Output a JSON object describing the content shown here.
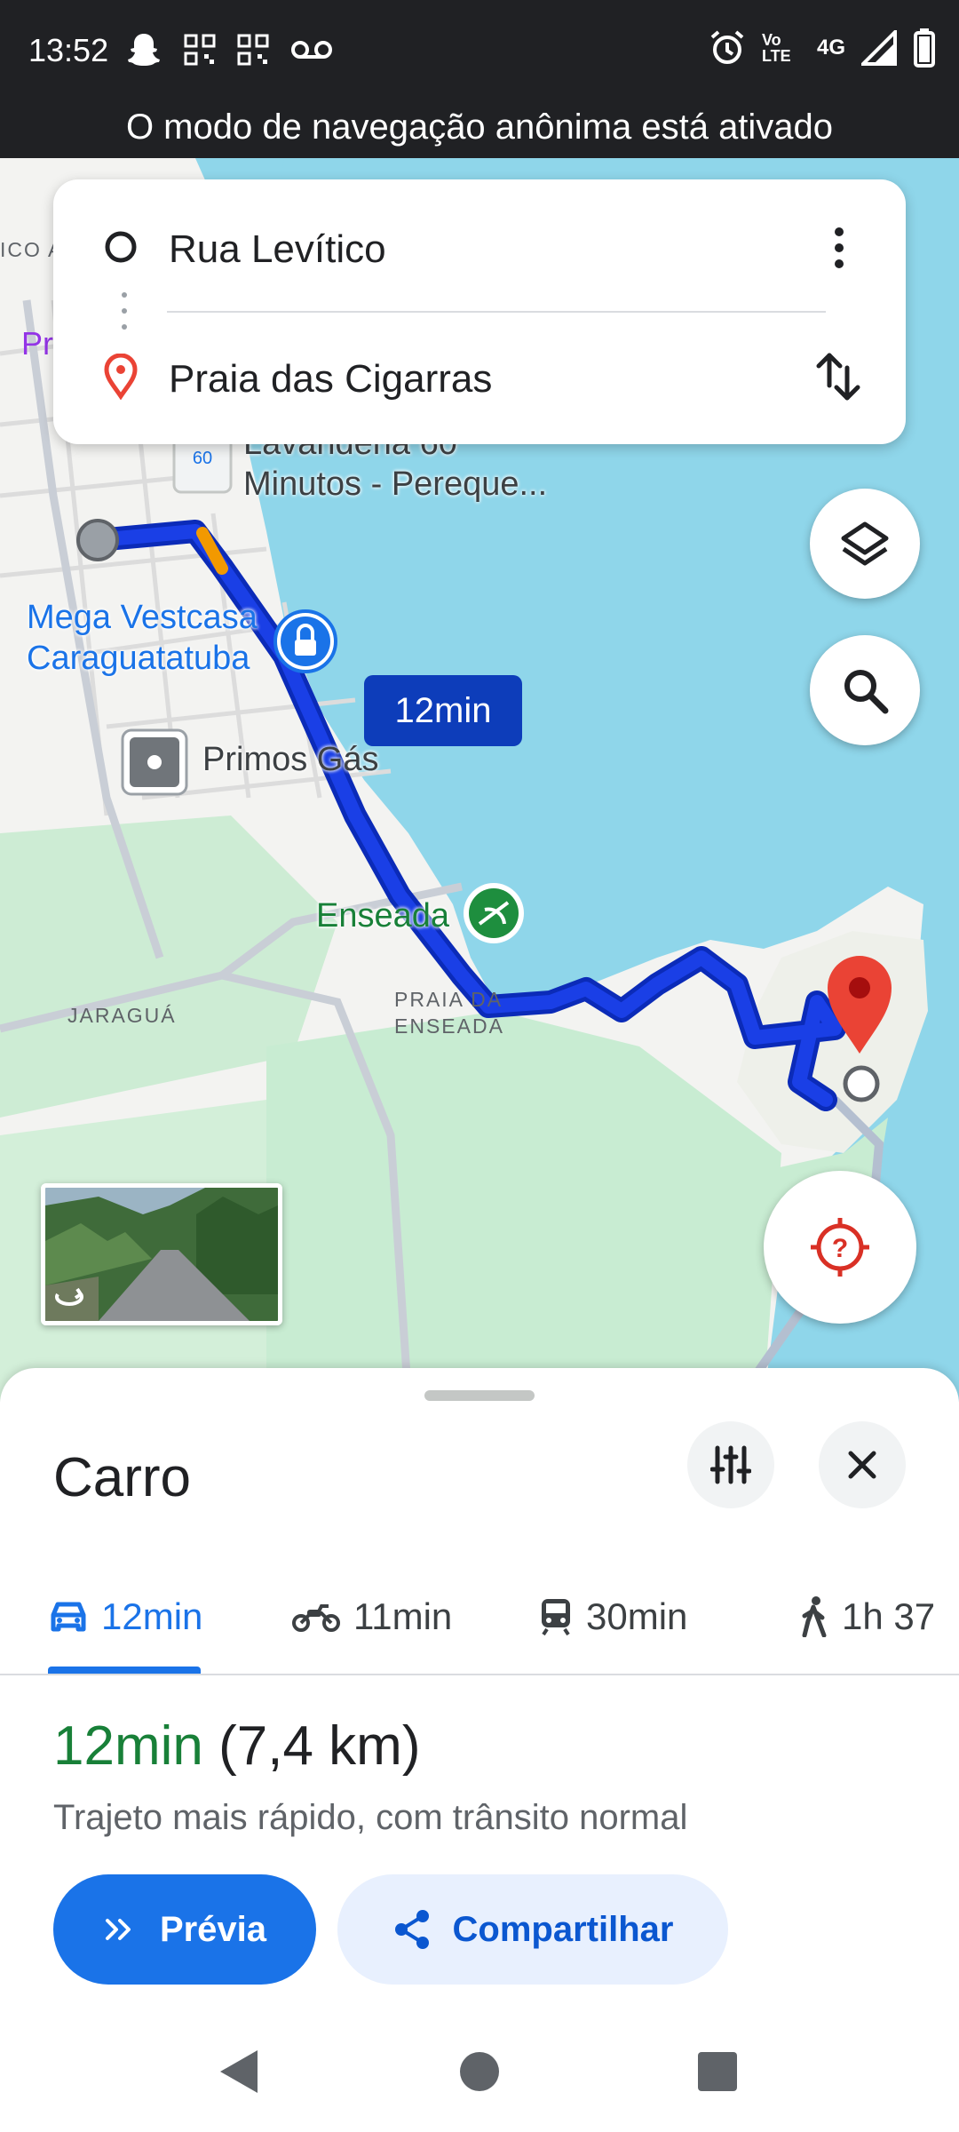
{
  "status_bar": {
    "time": "13:52",
    "network": "4G",
    "volte": "Vo LTE",
    "left_icons": [
      "snapchat-icon",
      "qr-code-icon",
      "qr-code-icon",
      "voicemail-icon"
    ],
    "right_icons": [
      "alarm-icon",
      "volte-icon",
      "signal-icon",
      "battery-icon"
    ]
  },
  "incognito_banner": "O modo de navegação anônima está ativado",
  "search": {
    "origin": "Rua Levítico",
    "destination": "Praia das Cigarras"
  },
  "map": {
    "labels": {
      "lavanderia_1": "Lavanderia 60",
      "lavanderia_2": "Minutos - Pereque...",
      "mega_1": "Mega Vestcasa",
      "mega_2": "Caraguatatuba",
      "primos": "Primos Gás",
      "enseada": "Enseada",
      "praia_1": "PRAIA DA",
      "praia_2": "ENSEADA",
      "jaragua": "JARAGUÁ",
      "edge_co": "ICO A",
      "edge_pr": "Pr"
    },
    "eta_bubble": "12min",
    "colors": {
      "water": "#8fd6ea",
      "route": "#1a3fe6",
      "route_outline": "#0b2bb8",
      "traffic": "#f29900",
      "park": "#c8ecd2",
      "destination_pin": "#ea4335"
    }
  },
  "sheet": {
    "title": "Carro",
    "modes": [
      {
        "icon": "car-icon",
        "label": "12min",
        "active": true
      },
      {
        "icon": "motorcycle-icon",
        "label": "11min",
        "active": false
      },
      {
        "icon": "train-icon",
        "label": "30min",
        "active": false
      },
      {
        "icon": "walk-icon",
        "label": "1h 37",
        "active": false
      }
    ],
    "eta_duration": "12min",
    "eta_distance": "(7,4 km)",
    "route_description": "Trajeto mais rápido, com trânsito normal",
    "preview_button": "Prévia",
    "share_button": "Compartilhar"
  },
  "accent_color": "#1a73e8"
}
